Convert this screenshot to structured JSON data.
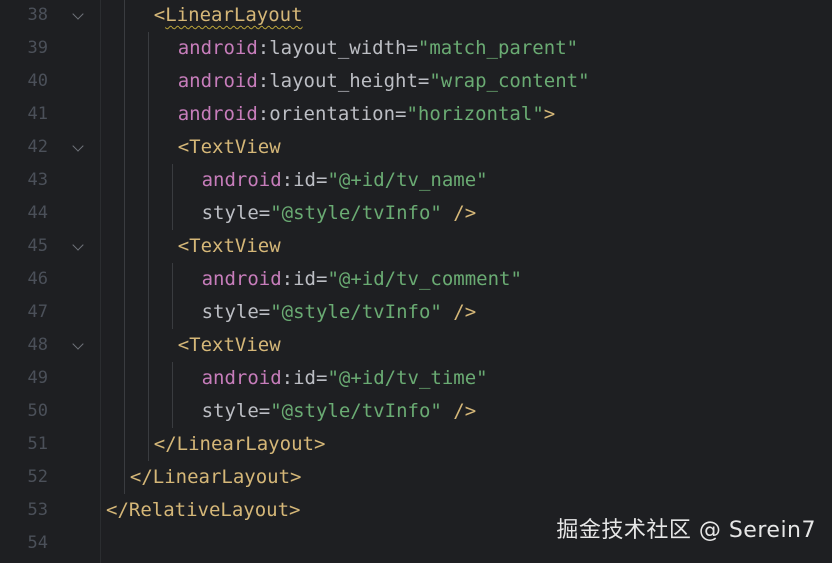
{
  "colors": {
    "background": "#1e1f22",
    "tag": "#d5b778",
    "namespace": "#c77dbb",
    "attribute": "#bcbec4",
    "value": "#6aab73",
    "line_number": "#4b5059"
  },
  "lines": [
    {
      "num": "38",
      "fold": true,
      "indent": 4,
      "tokens": [
        {
          "t": "<",
          "c": "tag"
        },
        {
          "t": "LinearLayout",
          "c": "tag",
          "squiggle": true
        }
      ]
    },
    {
      "num": "39",
      "fold": false,
      "indent": 6,
      "tokens": [
        {
          "t": "android",
          "c": "ns"
        },
        {
          "t": ":layout_width=",
          "c": "attr"
        },
        {
          "t": "\"match_parent\"",
          "c": "val"
        }
      ]
    },
    {
      "num": "40",
      "fold": false,
      "indent": 6,
      "tokens": [
        {
          "t": "android",
          "c": "ns"
        },
        {
          "t": ":layout_height=",
          "c": "attr"
        },
        {
          "t": "\"wrap_content\"",
          "c": "val"
        }
      ]
    },
    {
      "num": "41",
      "fold": false,
      "indent": 6,
      "tokens": [
        {
          "t": "android",
          "c": "ns"
        },
        {
          "t": ":orientation=",
          "c": "attr"
        },
        {
          "t": "\"horizontal\"",
          "c": "val"
        },
        {
          "t": ">",
          "c": "tag"
        }
      ]
    },
    {
      "num": "42",
      "fold": true,
      "indent": 6,
      "tokens": [
        {
          "t": "<TextView",
          "c": "tag"
        }
      ]
    },
    {
      "num": "43",
      "fold": false,
      "indent": 8,
      "tokens": [
        {
          "t": "android",
          "c": "ns"
        },
        {
          "t": ":id=",
          "c": "attr"
        },
        {
          "t": "\"@+id/tv_name\"",
          "c": "val"
        }
      ]
    },
    {
      "num": "44",
      "fold": false,
      "indent": 8,
      "tokens": [
        {
          "t": "style=",
          "c": "attr"
        },
        {
          "t": "\"@style/tvInfo\"",
          "c": "val"
        },
        {
          "t": " />",
          "c": "tag"
        }
      ]
    },
    {
      "num": "45",
      "fold": true,
      "indent": 6,
      "tokens": [
        {
          "t": "<TextView",
          "c": "tag"
        }
      ]
    },
    {
      "num": "46",
      "fold": false,
      "indent": 8,
      "tokens": [
        {
          "t": "android",
          "c": "ns"
        },
        {
          "t": ":id=",
          "c": "attr"
        },
        {
          "t": "\"@+id/tv_comment\"",
          "c": "val"
        }
      ]
    },
    {
      "num": "47",
      "fold": false,
      "indent": 8,
      "tokens": [
        {
          "t": "style=",
          "c": "attr"
        },
        {
          "t": "\"@style/tvInfo\"",
          "c": "val"
        },
        {
          "t": " />",
          "c": "tag"
        }
      ]
    },
    {
      "num": "48",
      "fold": true,
      "indent": 6,
      "tokens": [
        {
          "t": "<TextView",
          "c": "tag"
        }
      ]
    },
    {
      "num": "49",
      "fold": false,
      "indent": 8,
      "tokens": [
        {
          "t": "android",
          "c": "ns"
        },
        {
          "t": ":id=",
          "c": "attr"
        },
        {
          "t": "\"@+id/tv_time\"",
          "c": "val"
        }
      ]
    },
    {
      "num": "50",
      "fold": false,
      "indent": 8,
      "tokens": [
        {
          "t": "style=",
          "c": "attr"
        },
        {
          "t": "\"@style/tvInfo\"",
          "c": "val"
        },
        {
          "t": " />",
          "c": "tag"
        }
      ]
    },
    {
      "num": "51",
      "fold": false,
      "indent": 4,
      "tokens": [
        {
          "t": "</LinearLayout>",
          "c": "tag"
        }
      ]
    },
    {
      "num": "52",
      "fold": false,
      "indent": 2,
      "tokens": [
        {
          "t": "</LinearLayout>",
          "c": "tag"
        }
      ]
    },
    {
      "num": "53",
      "fold": false,
      "indent": 0,
      "tokens": [
        {
          "t": "</RelativeLayout>",
          "c": "tag"
        }
      ]
    },
    {
      "num": "54",
      "fold": false,
      "indent": 0,
      "tokens": []
    }
  ],
  "watermark": "掘金技术社区 @ Serein7"
}
